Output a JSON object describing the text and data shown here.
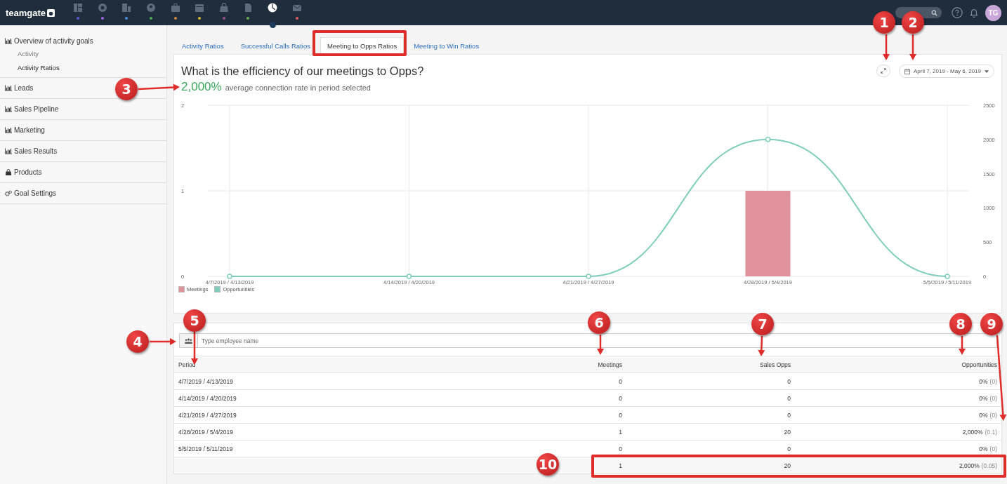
{
  "top_nav": {
    "logo": "teamgate",
    "items": [
      {
        "selected": false,
        "color": "#5b5bd6"
      },
      {
        "selected": false,
        "color": "#a066e0"
      },
      {
        "selected": false,
        "color": "#4a90d9"
      },
      {
        "selected": false,
        "color": "#4caf50"
      },
      {
        "selected": false,
        "color": "#d4883a"
      },
      {
        "selected": false,
        "color": "#d4b83a"
      },
      {
        "selected": false,
        "color": "#9c4d8e"
      },
      {
        "selected": false,
        "color": "#6aa84f"
      },
      {
        "selected": true,
        "color": "#1b3a5c"
      },
      {
        "selected": false,
        "color": "#e05a5a"
      }
    ],
    "user": {
      "initials": "TG"
    }
  },
  "sidebar": {
    "items": [
      {
        "kind": "report",
        "label": "Overview of activity goals",
        "expanded": true,
        "children": [
          {
            "label": "Activity",
            "selected": false
          },
          {
            "label": "Activity Ratios",
            "selected": true
          }
        ]
      },
      {
        "kind": "report",
        "label": "Leads"
      },
      {
        "kind": "report",
        "label": "Sales Pipeline"
      },
      {
        "kind": "report",
        "label": "Marketing"
      },
      {
        "kind": "report",
        "label": "Sales Results"
      },
      {
        "kind": "products",
        "label": "Products"
      },
      {
        "kind": "settings",
        "label": "Goal Settings"
      }
    ]
  },
  "tabs": [
    {
      "label": "Activity Ratios",
      "selected": false
    },
    {
      "label": "Successful Calls Ratios",
      "selected": false
    },
    {
      "label": "Meeting to Opps Ratios",
      "selected": true
    },
    {
      "label": "Meeting to Win Ratios",
      "selected": false
    }
  ],
  "chart_panel": {
    "title": "What is the efficiency of our meetings to Opps?",
    "rate": "2,000%",
    "rate_caption": "average connection rate in period selected",
    "date_range": "April 7, 2019 - May 6, 2019",
    "chart_data": {
      "type": "bar",
      "categories": [
        "4/7/2019 / 4/13/2019",
        "4/14/2019 / 4/20/2019",
        "4/21/2019 / 4/27/2019",
        "4/28/2019 / 5/4/2019",
        "5/5/2019 / 5/11/2019"
      ],
      "series": [
        {
          "name": "Meetings",
          "color": "#e0929c",
          "values": [
            0,
            0,
            0,
            1,
            0
          ]
        },
        {
          "name": "Opportunities",
          "type": "line",
          "axis": "y2",
          "marker": true,
          "color": "#7fcdbb",
          "values": [
            0,
            0,
            0,
            2000,
            0
          ]
        }
      ],
      "grid": "both",
      "ylim": [
        0,
        2
      ],
      "yticks": [
        0,
        1,
        2
      ],
      "y2lim": [
        0,
        2500
      ],
      "y2ticks": [
        0,
        500,
        1000,
        1500,
        2000,
        2500
      ]
    }
  },
  "table": {
    "filter_placeholder": "Type employee name",
    "columns": [
      "Period",
      "Meetings",
      "Sales Opps",
      "Opportunities"
    ],
    "rows": [
      {
        "period": "4/7/2019 / 4/13/2019",
        "meetings": "0",
        "sales_opps": "0",
        "ratio": "0%",
        "value": "(0)"
      },
      {
        "period": "4/14/2019 / 4/20/2019",
        "meetings": "0",
        "sales_opps": "0",
        "ratio": "0%",
        "value": "(0)"
      },
      {
        "period": "4/21/2019 / 4/27/2019",
        "meetings": "0",
        "sales_opps": "0",
        "ratio": "0%",
        "value": "(0)"
      },
      {
        "period": "4/28/2019 / 5/4/2019",
        "meetings": "1",
        "sales_opps": "20",
        "ratio": "2,000%",
        "value": "(0.1)"
      },
      {
        "period": "5/5/2019 / 5/11/2019",
        "meetings": "0",
        "sales_opps": "0",
        "ratio": "0%",
        "value": "(0)"
      }
    ],
    "totals": {
      "meetings": "1",
      "sales_opps": "20",
      "ratio": "2,000%",
      "value": "(0.05)"
    }
  },
  "annotations": [
    {
      "label": "1"
    },
    {
      "label": "2"
    },
    {
      "label": "3"
    },
    {
      "label": "4"
    },
    {
      "label": "5"
    },
    {
      "label": "6"
    },
    {
      "label": "7"
    },
    {
      "label": "8"
    },
    {
      "label": "9"
    },
    {
      "label": "10"
    }
  ]
}
